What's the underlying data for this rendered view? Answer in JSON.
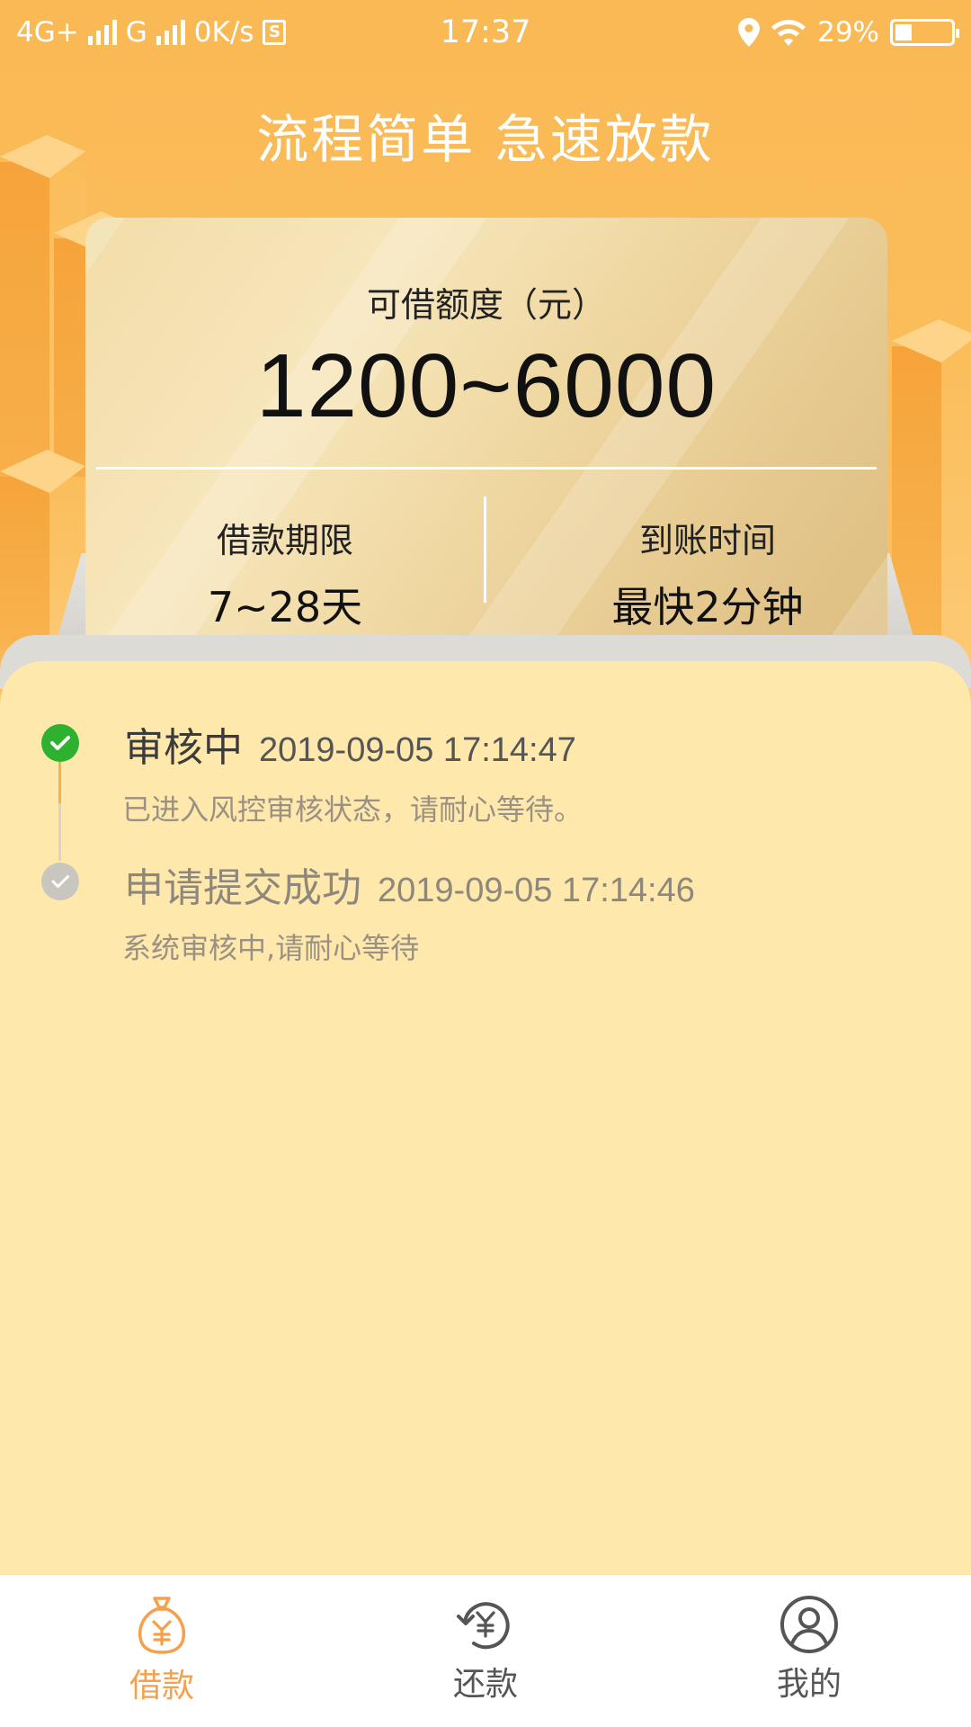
{
  "status_bar": {
    "network": "4G+",
    "network2": "G",
    "speed": "0K/s",
    "sim_badge": "S",
    "time": "17:37",
    "battery": "29%",
    "battery_level": 0.29
  },
  "header": {
    "title": "流程简单 急速放款"
  },
  "card": {
    "label": "可借额度（元）",
    "amount": "1200~6000",
    "left": {
      "key": "借款期限",
      "value": "7~28天"
    },
    "right": {
      "key": "到账时间",
      "value": "最快2分钟"
    }
  },
  "timeline": [
    {
      "title": "审核中",
      "time": "2019-09-05 17:14:47",
      "desc": "已进入风控审核状态，请耐心等待。",
      "state": "active"
    },
    {
      "title": "申请提交成功",
      "time": "2019-09-05 17:14:46",
      "desc": "系统审核中,请耐心等待",
      "state": "done"
    }
  ],
  "tabs": [
    {
      "label": "借款",
      "icon": "money-bag-icon",
      "active": true
    },
    {
      "label": "还款",
      "icon": "repay-icon",
      "active": false
    },
    {
      "label": "我的",
      "icon": "profile-icon",
      "active": false
    }
  ],
  "colors": {
    "primary": "#F9B955",
    "active_tab": "#F7A04B",
    "inactive_tab": "#555555",
    "check_green": "#2DB12F",
    "check_gray": "#C9C6C0"
  }
}
